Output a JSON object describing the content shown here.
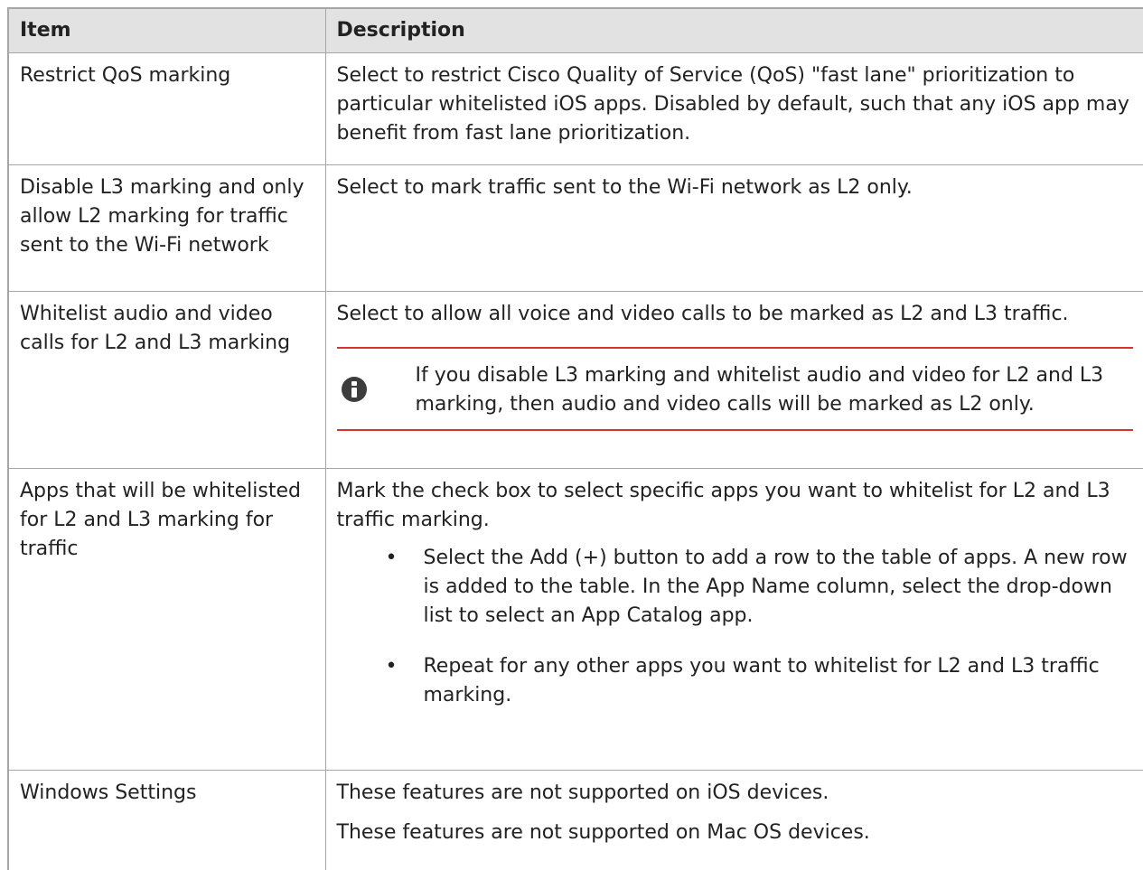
{
  "table": {
    "headers": {
      "item": "Item",
      "description": "Description"
    },
    "rows": [
      {
        "item": "Restrict QoS marking",
        "description": "Select to restrict Cisco Quality of Service (QoS) \"fast lane\" prioritization to particular whitelisted iOS apps. Disabled by default, such that any iOS app may benefit from fast lane prioritization."
      },
      {
        "item": "Disable L3 marking and only allow L2 marking for traffic sent to the Wi-Fi network",
        "description": "Select to mark traffic sent to the Wi-Fi network as L2 only."
      },
      {
        "item": "Whitelist audio and video calls for L2 and L3 marking",
        "description": "Select to allow all voice and video calls to be marked as L2 and L3 traffic.",
        "note": {
          "icon": "info-icon",
          "text": "If you disable L3 marking and whitelist audio and video for L2 and L3 marking, then audio and video calls will be marked as L2 only."
        }
      },
      {
        "item": "Apps that will be whitelisted for L2 and L3 marking for traffic",
        "description": "Mark the check box to select specific apps you want to whitelist for L2 and L3 traffic marking.",
        "bullet_char": "•",
        "bullets": [
          "Select the Add (+) button to add a row to the table of apps. A new row is added to the table. In the App Name column, select the drop-down list to select an App Catalog app.",
          "Repeat for any other apps you want to whitelist for L2 and L3 traffic marking."
        ]
      },
      {
        "item": "Windows Settings",
        "lines": [
          "These features are not supported on iOS devices.",
          "These features are not supported on Mac OS devices."
        ]
      }
    ]
  },
  "colors": {
    "header_bg": "#e2e2e2",
    "border": "#a6a6a6",
    "note_rule": "#d9342b",
    "info_icon": "#3d3d3d"
  }
}
